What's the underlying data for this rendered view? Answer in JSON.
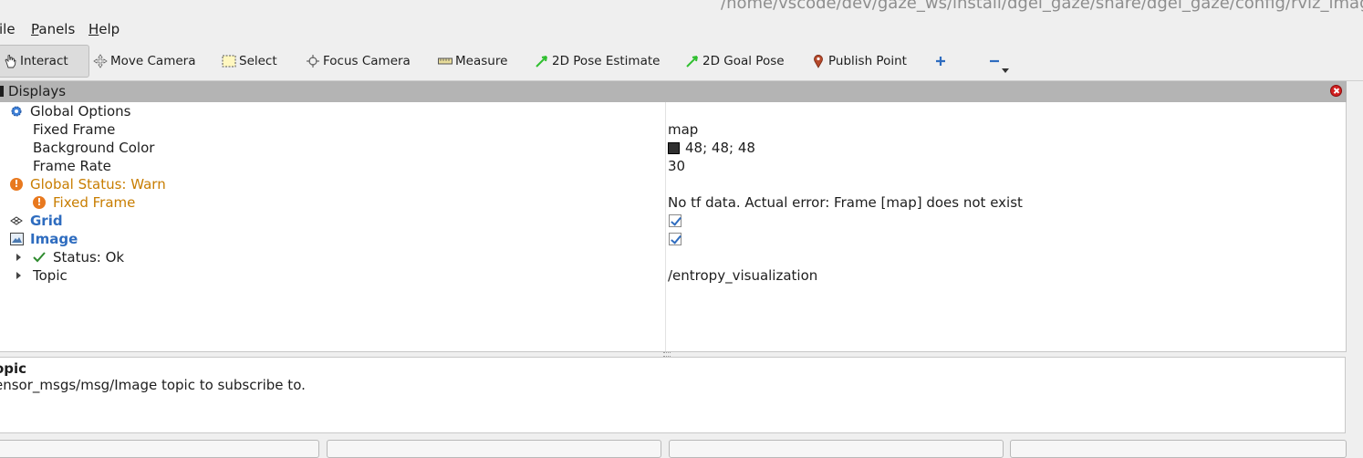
{
  "window": {
    "title_path": "/home/vscode/dev/gaze_ws/install/dgel_gaze/share/dgel_gaze/config/rviz_imag"
  },
  "menu": {
    "file": "ile",
    "panels_first": "P",
    "panels_rest": "anels",
    "help_first": "H",
    "help_rest": "elp"
  },
  "toolbar": {
    "interact": "Interact",
    "move_camera": "Move Camera",
    "select": "Select",
    "focus_camera": "Focus Camera",
    "measure": "Measure",
    "pose_estimate": "2D Pose Estimate",
    "goal_pose": "2D Goal Pose",
    "publish_point": "Publish Point"
  },
  "displays": {
    "title": "Displays",
    "rows": [
      {
        "name": "Global Options",
        "value": ""
      },
      {
        "name": "Fixed Frame",
        "value": "map"
      },
      {
        "name": "Background Color",
        "value": "48; 48; 48"
      },
      {
        "name": "Frame Rate",
        "value": "30"
      },
      {
        "name": "Global Status: Warn",
        "value": ""
      },
      {
        "name": "Fixed Frame",
        "value": "No tf data.  Actual error: Frame [map] does not exist"
      },
      {
        "name": "Grid",
        "value": ""
      },
      {
        "name": "Image",
        "value": ""
      },
      {
        "name": "Status: Ok",
        "value": ""
      },
      {
        "name": "Topic",
        "value": "/entropy_visualization"
      }
    ],
    "grid_enabled": true,
    "image_enabled": true,
    "background_color_hex": "#303030"
  },
  "description": {
    "title": "opic",
    "text": "ensor_msgs/msg/Image topic to subscribe to."
  },
  "colors": {
    "warn": "#c87d00",
    "display_name": "#2e6cbf",
    "panel_header": "#b4b4b4",
    "ok_check": "#2e8b2e"
  }
}
